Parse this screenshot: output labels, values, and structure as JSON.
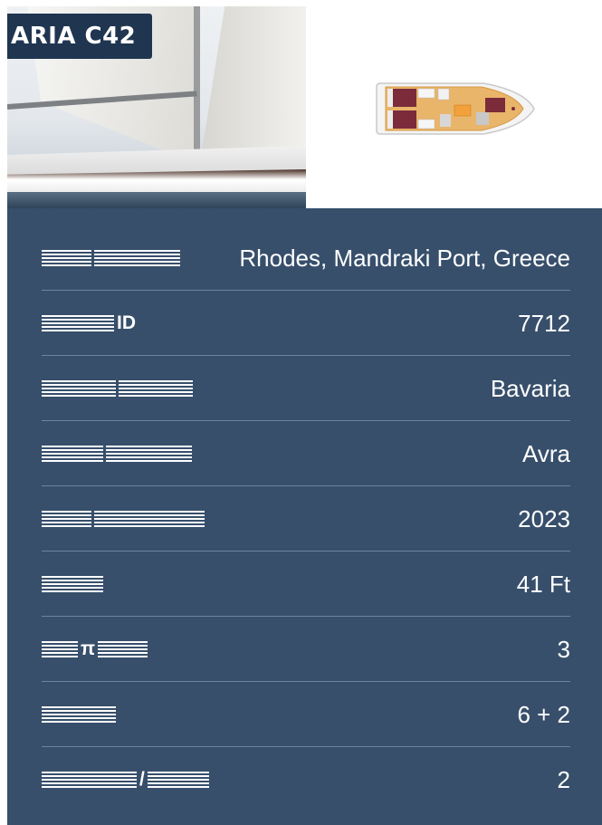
{
  "photo": {
    "label": "ARIA C42"
  },
  "specs": [
    {
      "label_visible": "",
      "value": "Rhodes, Mandraki Port, Greece"
    },
    {
      "label_visible": "ID",
      "value": "7712"
    },
    {
      "label_visible": "",
      "value": "Bavaria"
    },
    {
      "label_visible": "",
      "value": "Avra"
    },
    {
      "label_visible": "",
      "value": "2023"
    },
    {
      "label_visible": "",
      "value": "41 Ft"
    },
    {
      "label_visible": "π",
      "value": "3"
    },
    {
      "label_visible": "",
      "value": "6 + 2"
    },
    {
      "label_visible": "/",
      "value": "2"
    }
  ],
  "colors": {
    "panel": "#374f6b",
    "divider": "#6e839b",
    "label_bg": "#1f3550"
  }
}
